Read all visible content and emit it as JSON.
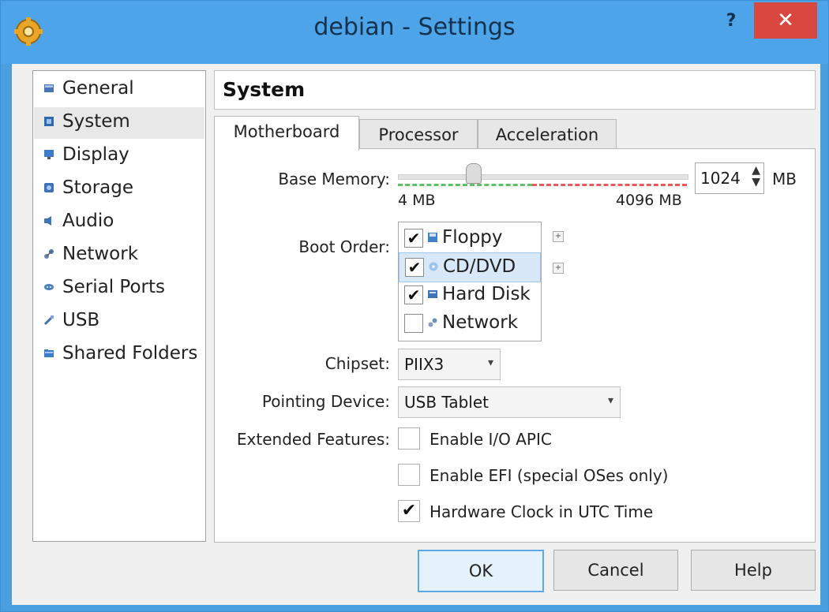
{
  "window": {
    "title": "debian - Settings",
    "help_label": "?",
    "close_label": "✕",
    "app_icon": "gear-icon",
    "titlebar_color": "#4ea4e8",
    "close_color": "#d9483f"
  },
  "sidebar": {
    "items": [
      {
        "label": "General",
        "icon": "general-icon",
        "selected": false
      },
      {
        "label": "System",
        "icon": "system-icon",
        "selected": true
      },
      {
        "label": "Display",
        "icon": "display-icon",
        "selected": false
      },
      {
        "label": "Storage",
        "icon": "storage-icon",
        "selected": false
      },
      {
        "label": "Audio",
        "icon": "audio-icon",
        "selected": false
      },
      {
        "label": "Network",
        "icon": "network-icon",
        "selected": false
      },
      {
        "label": "Serial Ports",
        "icon": "serial-ports-icon",
        "selected": false
      },
      {
        "label": "USB",
        "icon": "usb-icon",
        "selected": false
      },
      {
        "label": "Shared Folders",
        "icon": "shared-folders-icon",
        "selected": false
      }
    ]
  },
  "section": {
    "title": "System"
  },
  "tabs": [
    {
      "label": "Motherboard",
      "active": true
    },
    {
      "label": "Processor",
      "active": false
    },
    {
      "label": "Acceleration",
      "active": false
    }
  ],
  "motherboard": {
    "base_memory": {
      "label": "Base Memory:",
      "value": "1024",
      "unit": "MB",
      "min_label": "4 MB",
      "max_label": "4096 MB",
      "slider_fraction": 0.25
    },
    "boot_order": {
      "label": "Boot Order:",
      "items": [
        {
          "label": "Floppy",
          "checked": true,
          "icon": "floppy-icon",
          "selected": false
        },
        {
          "label": "CD/DVD",
          "checked": true,
          "icon": "cd-dvd-icon",
          "selected": true
        },
        {
          "label": "Hard Disk",
          "checked": true,
          "icon": "hard-disk-icon",
          "selected": false
        },
        {
          "label": "Network",
          "checked": false,
          "icon": "network-icon",
          "selected": false
        }
      ]
    },
    "chipset": {
      "label": "Chipset:",
      "value": "PIIX3"
    },
    "pointing_device": {
      "label": "Pointing Device:",
      "value": "USB Tablet"
    },
    "extended_features": {
      "label": "Extended Features:",
      "options": [
        {
          "label": "Enable I/O APIC",
          "checked": false
        },
        {
          "label": "Enable EFI (special OSes only)",
          "checked": false
        },
        {
          "label": "Hardware Clock in UTC Time",
          "checked": true
        }
      ]
    }
  },
  "buttons": {
    "ok": "OK",
    "cancel": "Cancel",
    "help": "Help"
  }
}
